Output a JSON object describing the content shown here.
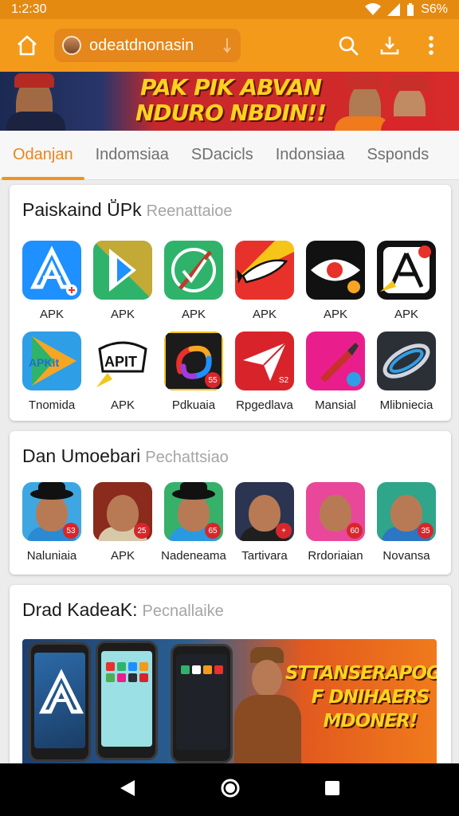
{
  "status_bar": {
    "time": "1:2:30",
    "battery": "S6%"
  },
  "app_bar": {
    "search_text": "odeatdnonasin"
  },
  "hero_banner": {
    "line1": "PAK PIK ABVAN",
    "line2": "NDURO NBDIN!!"
  },
  "tabs": [
    {
      "label": "Odanjan",
      "active": true
    },
    {
      "label": "Indomsiaa",
      "active": false
    },
    {
      "label": "SDacicls",
      "active": false
    },
    {
      "label": "Indonsiaa",
      "active": false
    },
    {
      "label": "Ssponds",
      "active": false
    }
  ],
  "section1": {
    "title": "Paiskaind ṺPk",
    "subtitle": "Reenattaioe",
    "row1": [
      {
        "label": "APK",
        "icon": "stylized-a-app-icon",
        "color": "#1e90ff"
      },
      {
        "label": "APK",
        "icon": "play-style-arrow-icon",
        "color": "#4caf50"
      },
      {
        "label": "APK",
        "icon": "green-brush-icon",
        "color": "#2fb36b"
      },
      {
        "label": "APK",
        "icon": "red-fish-icon",
        "color": "#e8312a"
      },
      {
        "label": "APK",
        "icon": "black-fish-icon",
        "color": "#111111"
      },
      {
        "label": "APK",
        "icon": "black-a-pen-icon",
        "color": "#111111"
      }
    ],
    "row2": [
      {
        "label": "Tnomida",
        "icon": "play-store-triangle-icon",
        "color": "#2e9fe6",
        "overlay": "APKit"
      },
      {
        "label": "APK",
        "icon": "apit-pen-icon",
        "color": "#ffffff",
        "overlay": "APIT"
      },
      {
        "label": "Pdkuaia",
        "icon": "colorful-s-icon",
        "color": "#1b1b1b",
        "badge": "55"
      },
      {
        "label": "Rpgedlava",
        "icon": "paper-plane-icon",
        "color": "#d9232a",
        "badge": "S2"
      },
      {
        "label": "Mansial",
        "icon": "lipstick-icon",
        "color": "#e91e8c"
      },
      {
        "label": "Mlibniecia",
        "icon": "orbit-ring-icon",
        "color": "#2b2f36"
      }
    ]
  },
  "section2": {
    "title": "Dan Umoebari",
    "subtitle": "Pechattsiao",
    "people": [
      {
        "label": "Naluniaia",
        "badge": "53",
        "bg": "#3ea7e2",
        "shirt": "#2a8ad2",
        "hat": true
      },
      {
        "label": "APK",
        "badge": "25",
        "bg": "#8a2b1e",
        "shirt": "#d7c9a8",
        "hat": false
      },
      {
        "label": "Nadeneama",
        "badge": "65",
        "bg": "#37b06a",
        "shirt": "#2a9ae0",
        "hat": true
      },
      {
        "label": "Tartivara",
        "badge": "+",
        "bg": "#2b3552",
        "shirt": "#1f1f1f",
        "hat": false
      },
      {
        "label": "Rrdoriaian",
        "badge": "60",
        "bg": "#e9479a",
        "shirt": "#e9479a",
        "hat": false
      },
      {
        "label": "Novansa",
        "badge": "35",
        "bg": "#2fa58a",
        "shirt": "#2b77c4",
        "hat": false
      }
    ]
  },
  "section3": {
    "title": "Drad KadeaK:",
    "subtitle": "Pecnallaike",
    "promo": {
      "line1": "STTANSERAPOGH",
      "line2": "F DNIHAERS",
      "line3": "MDONER!"
    }
  }
}
